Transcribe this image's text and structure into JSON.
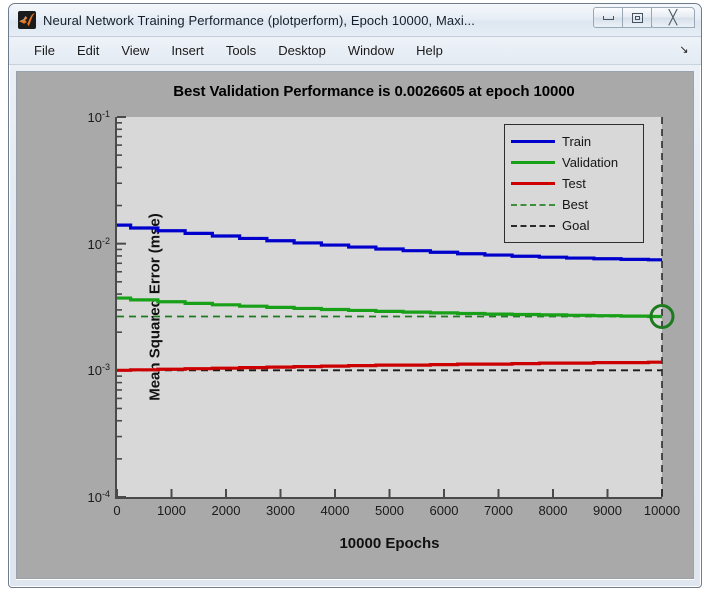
{
  "window": {
    "title": "Neural Network Training Performance (plotperform), Epoch 10000, Maxi...",
    "icon": "matlab-icon",
    "buttons": {
      "minimize": "minimize-icon",
      "maximize": "maximize-icon",
      "close": "╳"
    }
  },
  "menu": {
    "items": [
      {
        "label": "File"
      },
      {
        "label": "Edit"
      },
      {
        "label": "View"
      },
      {
        "label": "Insert"
      },
      {
        "label": "Tools"
      },
      {
        "label": "Desktop"
      },
      {
        "label": "Window"
      },
      {
        "label": "Help"
      }
    ],
    "expand_glyph": "↘"
  },
  "chart_data": {
    "type": "line",
    "title": "Best Validation Performance is 0.0026605 at epoch 10000",
    "xlabel": "10000 Epochs",
    "ylabel": "Mean Squared Error  (mse)",
    "xlim": [
      0,
      10000
    ],
    "ylim": [
      0.0001,
      0.1
    ],
    "yscale": "log",
    "xscale": "linear",
    "grid": false,
    "legend_position": "top-right",
    "xticks": [
      0,
      1000,
      2000,
      3000,
      4000,
      5000,
      6000,
      7000,
      8000,
      9000,
      10000
    ],
    "xtick_labels": [
      "0",
      "1000",
      "2000",
      "3000",
      "4000",
      "5000",
      "6000",
      "7000",
      "8000",
      "9000",
      "10000"
    ],
    "yticks": [
      0.0001,
      0.001,
      0.01,
      0.1
    ],
    "ytick_labels": [
      "10-4",
      "10-3",
      "10-2",
      "10-1"
    ],
    "best_value": 0.0026605,
    "best_epoch": 10000,
    "goal_value": 0.001,
    "series": [
      {
        "name": "Train",
        "color": "#0000CC",
        "style": "solid",
        "x": [
          0,
          500,
          1000,
          1500,
          2000,
          2500,
          3000,
          3500,
          4000,
          4500,
          5000,
          5500,
          6000,
          6500,
          7000,
          7500,
          8000,
          8500,
          9000,
          9500,
          10000
        ],
        "values": [
          0.014,
          0.0133,
          0.01265,
          0.01205,
          0.0115,
          0.011,
          0.01055,
          0.01013,
          0.00975,
          0.0094,
          0.00908,
          0.0088,
          0.00855,
          0.00833,
          0.00813,
          0.00796,
          0.00782,
          0.0077,
          0.0076,
          0.00752,
          0.00746
        ]
      },
      {
        "name": "Validation",
        "color": "#18A018",
        "style": "solid",
        "x": [
          0,
          500,
          1000,
          1500,
          2000,
          2500,
          3000,
          3500,
          4000,
          4500,
          5000,
          5500,
          6000,
          6500,
          7000,
          7500,
          8000,
          8500,
          9000,
          9500,
          10000
        ],
        "values": [
          0.00372,
          0.0036,
          0.00348,
          0.00338,
          0.00329,
          0.00321,
          0.00314,
          0.00308,
          0.00302,
          0.00297,
          0.00292,
          0.00288,
          0.00284,
          0.00281,
          0.00278,
          0.00276,
          0.00274,
          0.00272,
          0.0027,
          0.00268,
          0.0026605
        ]
      },
      {
        "name": "Test",
        "color": "#CC0000",
        "style": "solid",
        "x": [
          0,
          500,
          1000,
          1500,
          2000,
          2500,
          3000,
          3500,
          4000,
          4500,
          5000,
          5500,
          6000,
          6500,
          7000,
          7500,
          8000,
          8500,
          9000,
          9500,
          10000
        ],
        "values": [
          0.001,
          0.00101,
          0.00102,
          0.00103,
          0.00104,
          0.00105,
          0.00106,
          0.00107,
          0.00108,
          0.00109,
          0.0011,
          0.0011,
          0.00111,
          0.00112,
          0.00112,
          0.00113,
          0.00114,
          0.00114,
          0.00115,
          0.00115,
          0.00116
        ]
      },
      {
        "name": "Best",
        "color": "#1E7A1E",
        "style": "dashed",
        "value": 0.0026605
      },
      {
        "name": "Goal",
        "color": "#1A1A1A",
        "style": "dashed",
        "value": 0.001
      }
    ],
    "legend": [
      {
        "label": "Train",
        "color": "#0000CC",
        "style": "solid"
      },
      {
        "label": "Validation",
        "color": "#18A018",
        "style": "solid"
      },
      {
        "label": "Test",
        "color": "#CC0000",
        "style": "solid"
      },
      {
        "label": "Best",
        "color": "#3E8E3E",
        "style": "dashed"
      },
      {
        "label": "Goal",
        "color": "#2A2A2A",
        "style": "dashed"
      }
    ],
    "marker": {
      "name": "best-validation-marker",
      "x": 10000,
      "y": 0.0026605,
      "color": "#1E7A1E",
      "shape": "circle"
    }
  },
  "colors": {
    "figure_background": "#A9A9A9",
    "axes_background": "#D8D8D8",
    "axis_line": "#4A4A4A"
  }
}
